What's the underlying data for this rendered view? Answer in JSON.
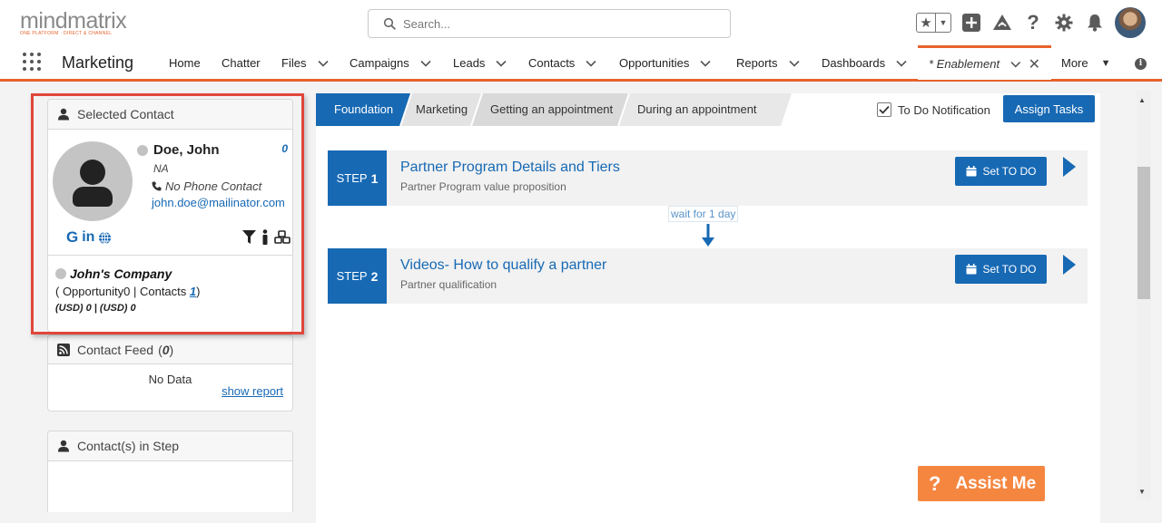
{
  "header": {
    "logo_main": "mindmatrix",
    "logo_tag": "ONE PLATFORM · DIRECT & CHANNEL",
    "search_placeholder": "Search..."
  },
  "nav": {
    "app_name": "Marketing",
    "items": [
      {
        "label": "Home"
      },
      {
        "label": "Chatter"
      },
      {
        "label": "Files"
      },
      {
        "label": "Campaigns"
      },
      {
        "label": "Leads"
      },
      {
        "label": "Contacts"
      },
      {
        "label": "Opportunities"
      },
      {
        "label": "Reports"
      },
      {
        "label": "Dashboards"
      }
    ],
    "active_tab": "* Enablement",
    "more": "More"
  },
  "selected_contact": {
    "header": "Selected Contact",
    "name": "Doe, John",
    "score": "0",
    "title": "NA",
    "phone": "No Phone Contact",
    "email": "john.doe@mailinator.com",
    "company": "John's Company",
    "stats_prefix": "( Opportunity0 | Contacts ",
    "contacts_count": "1",
    "stats_suffix": ")",
    "money": "(USD) 0 | (USD) 0"
  },
  "contact_feed": {
    "header_prefix": "Contact Feed",
    "count_open": "(",
    "count": "0",
    "count_close": ")",
    "empty": "No Data",
    "show_report": "show report"
  },
  "contacts_in_step": {
    "header": "Contact(s) in Step"
  },
  "stages": [
    {
      "label": "Foundation"
    },
    {
      "label": "Marketing"
    },
    {
      "label": "Getting an appointment"
    },
    {
      "label": "During an appointment"
    }
  ],
  "todo_notification": "To Do Notification",
  "assign_tasks": "Assign Tasks",
  "steps": [
    {
      "prefix": "STEP",
      "num": "1",
      "title": "Partner Program Details and Tiers",
      "subtitle": "Partner Program value proposition",
      "button": "Set TO DO"
    },
    {
      "prefix": "STEP",
      "num": "2",
      "title": "Videos- How to qualify a partner",
      "subtitle": "Partner qualification",
      "button": "Set TO DO"
    }
  ],
  "wait_label": "wait for 1 day",
  "assist": {
    "label": "Assist Me",
    "icon": "?"
  },
  "colors": {
    "brand_orange": "#e8622c",
    "primary_blue": "#1769b4",
    "assist_orange": "#f58640",
    "highlight_red": "#e0463a"
  }
}
